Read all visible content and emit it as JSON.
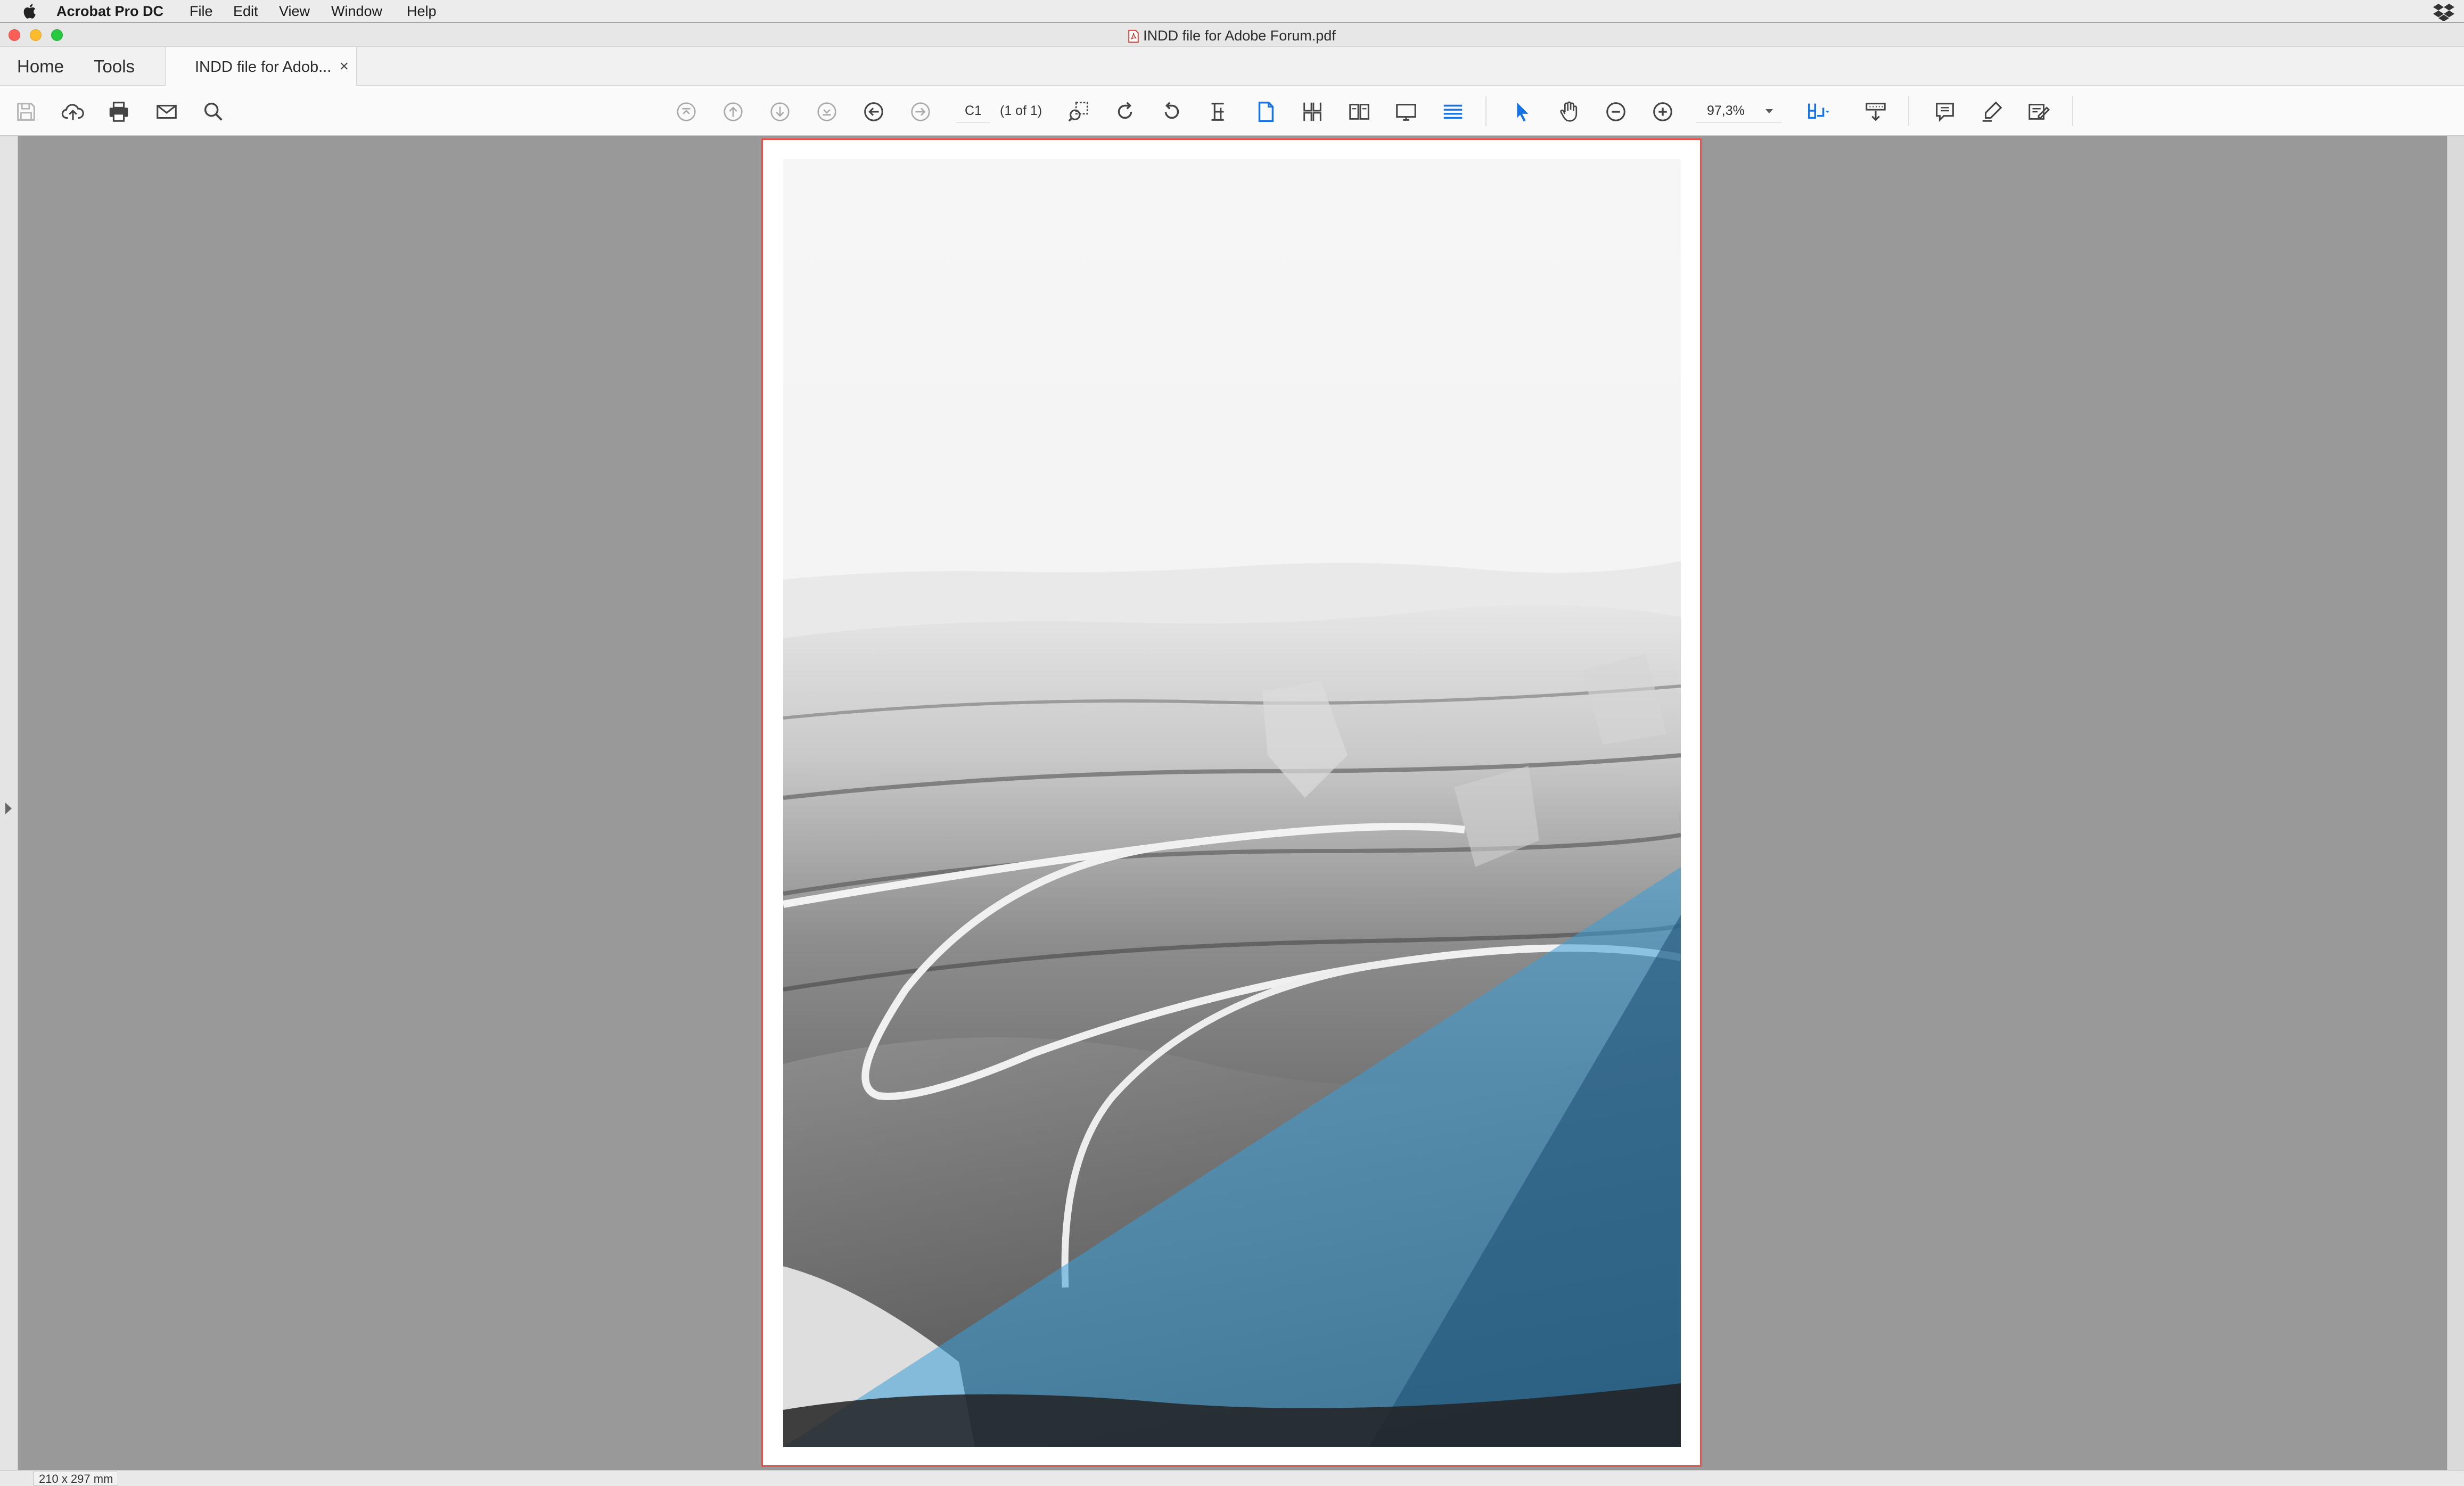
{
  "menubar": {
    "app_name": "Acrobat Pro DC",
    "items": [
      "File",
      "Edit",
      "View",
      "Window",
      "Help"
    ]
  },
  "window": {
    "title": "INDD file for Adobe Forum.pdf"
  },
  "tabs": {
    "home": "Home",
    "tools": "Tools",
    "document": "INDD file for Adob...",
    "close": "×"
  },
  "toolbar": {
    "page_field": "C1",
    "page_of": "(1 of 1)",
    "zoom": "97,3%",
    "accent_color": "#1473e6"
  },
  "status": {
    "page_size": "210 x 297 mm"
  },
  "colors": {
    "page_border": "#e8524a",
    "workspace": "#999999",
    "overlay_blue": "#3a9fd8"
  }
}
